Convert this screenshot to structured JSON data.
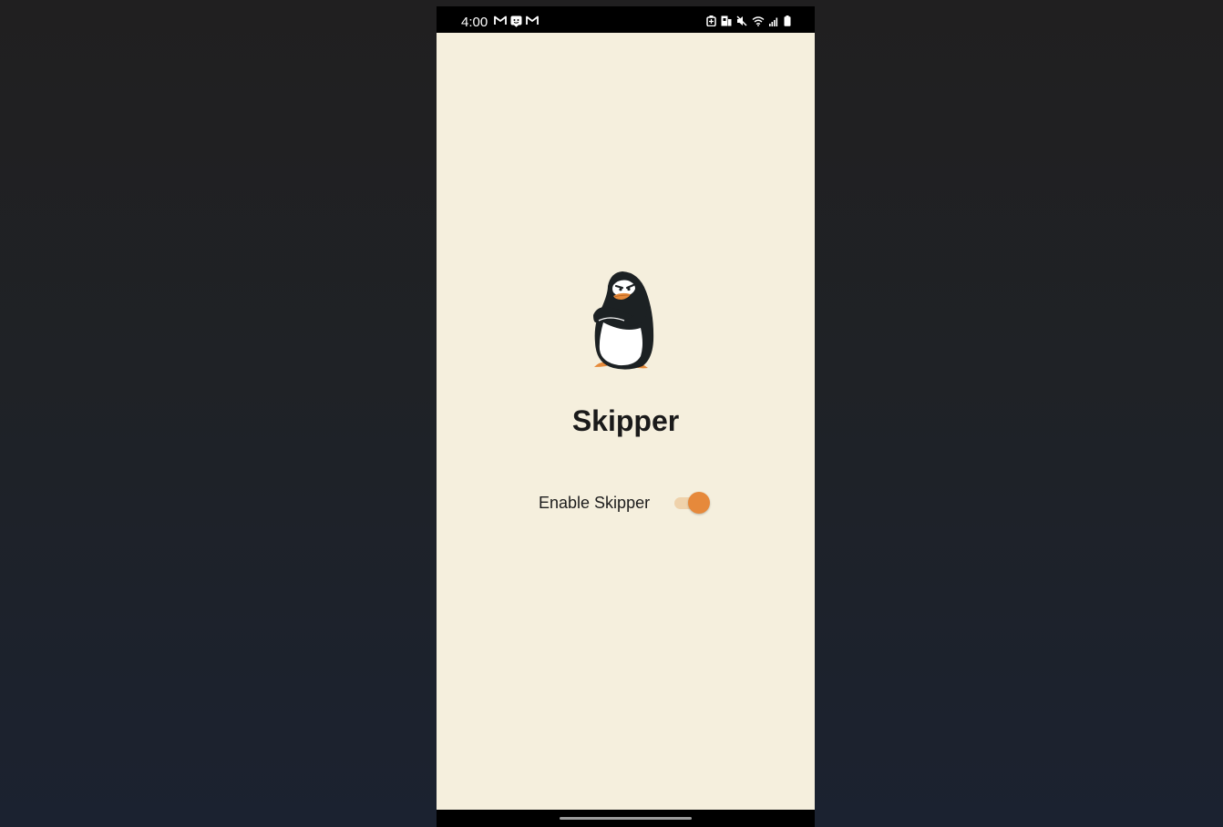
{
  "status_bar": {
    "time": "4:00",
    "left_icons": [
      "gmail-icon",
      "notification-app-icon",
      "gmail-icon"
    ],
    "right_icons": [
      "battery-saver-icon",
      "nfc-icon",
      "mute-icon",
      "wifi-icon",
      "signal-icon",
      "battery-icon"
    ]
  },
  "app": {
    "title": "Skipper",
    "toggle_label": "Enable Skipper",
    "toggle_on": true,
    "accent_color": "#e6893b",
    "background_color": "#f5efdd"
  }
}
